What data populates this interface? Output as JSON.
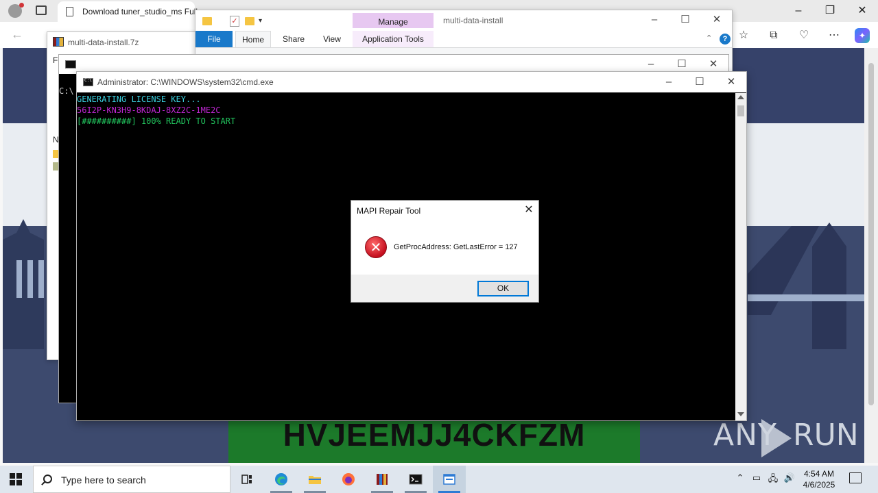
{
  "browser": {
    "tab_title": "Download tuner_studio_ms Full",
    "license_key_banner": "HVJEEMJJ4CKFZM",
    "watermark_left": "ANY",
    "watermark_right": "RUN"
  },
  "archive_window": {
    "title": "multi-data-install.7z",
    "menu_fragment": "Fi",
    "list_fragment": "N"
  },
  "explorer": {
    "title": "multi-data-install",
    "manage_label": "Manage",
    "tabs": [
      "File",
      "Home",
      "Share",
      "View",
      "Application Tools"
    ],
    "help_label": "?"
  },
  "cmd_back": {
    "prompt_fragment": "C:\\"
  },
  "cmd": {
    "title": "Administrator: C:\\WINDOWS\\system32\\cmd.exe",
    "lines": [
      {
        "text": "GENERATING LICENSE KEY...",
        "color": "#3ad1e0"
      },
      {
        "text": "56I2P-KN3H9-8KDAJ-8XZ2C-1ME2C",
        "color": "#c026d3"
      },
      {
        "text": "[##########] 100% READY TO START",
        "color": "#22c55e"
      }
    ]
  },
  "dialog": {
    "title": "MAPI Repair Tool",
    "message": "GetProcAddress: GetLastError = 127",
    "ok_label": "OK",
    "icon": "error-icon"
  },
  "taskbar": {
    "search_placeholder": "Type here to search",
    "time": "4:54 AM",
    "date": "4/6/2025",
    "apps": [
      "task-view",
      "edge",
      "file-explorer",
      "firefox",
      "winrar",
      "cmd",
      "mapi-repair-tool"
    ]
  }
}
